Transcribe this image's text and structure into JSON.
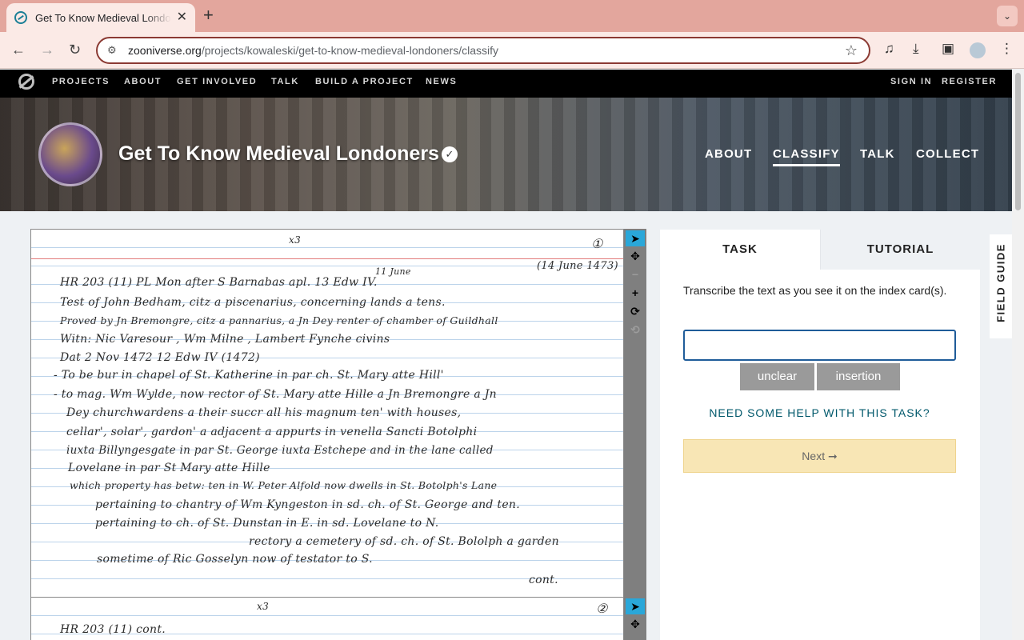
{
  "browser": {
    "tab_title": "Get To Know Medieval Londoners",
    "tab_close": "✕",
    "new_tab": "+",
    "url_host": "zooniverse.org",
    "url_path": "/projects/kowaleski/get-to-know-medieval-londoners/classify"
  },
  "site_nav": {
    "items": [
      "PROJECTS",
      "ABOUT",
      "GET INVOLVED",
      "TALK",
      "BUILD A PROJECT",
      "NEWS"
    ],
    "sign_in": "SIGN IN",
    "register": "REGISTER"
  },
  "project": {
    "title": "Get To Know Medieval Londoners",
    "verified_mark": "✓",
    "nav": [
      "ABOUT",
      "CLASSIFY",
      "TALK",
      "COLLECT"
    ],
    "active_nav": "CLASSIFY"
  },
  "subject_card_1": {
    "corner_number": "①",
    "top_mark": "x3",
    "date_note_top": "11 June",
    "date_note_right": "(14 June 1473)",
    "lines": [
      "HR 203 (11)        PL    Mon after S Barnabas apl.  13 Edw IV.",
      "Test of   John  Bedham,   citz a piscenarius,  concerning  lands a tens.",
      "Proved by   Jn  Bremongre,  citz a pannarius,  a  Jn  Dey   renter of chamber of Guildhall",
      "Witn:   Nic  Varesour ,   Wm  Milne ,  Lambert  Fynche  civins",
      "Dat  2 Nov    1472        12 Edw IV    (1472)",
      "- To  be  bur  in  chapel  of    St. Katherine  in  par  ch.   St. Mary  atte  Hill'",
      "- to  mag.  Wm  Wylde,  now  rector  of  St. Mary  atte  Hille  a  Jn  Bremongre a  Jn",
      "Dey   churchwardens  a  their  succr     all  his    magnum  ten'  with  houses,",
      "cellar',   solar',   gardon'  a  adjacent   a  appurts     in   venella  Sancti  Botolphi",
      "iuxta  Billyngesgate    in   par  St. George  iuxta  Estchepe    and  in  the  lane  called",
      "Lovelane    in    par    St  Mary   atte  Hille",
      "which  property  has  betw:    ten   in   W.    Peter  Alfold  now  dwells   in   St. Botolph's Lane",
      "pertaining   to  chantry of   Wm   Kyngeston   in sd. ch.   of   St. George   and   ten.",
      "pertaining    to   ch.  of    St. Dunstan  in  E.   in  sd.   Lovelane   to    N.",
      "rectory  a  cemetery  of   sd.  ch.  of  St. Bololph  a  garden",
      "sometime  of   Ric  Gosselyn     now  of   testator    to    S.",
      "cont."
    ]
  },
  "subject_card_2": {
    "corner_number": "②",
    "top_mark": "x3",
    "first_line": "HR  203  (11)    cont."
  },
  "viewer_tools": {
    "pointer": "➤",
    "move": "✥",
    "zoom_out": "−",
    "zoom_in": "+",
    "rotate": "⟳",
    "reset": "⟲"
  },
  "task_panel": {
    "tab_task": "TASK",
    "tab_tutorial": "TUTORIAL",
    "instruction": "Transcribe the text as you see it on the index card(s).",
    "answer_value": "",
    "unclear_label": "unclear",
    "insertion_label": "insertion",
    "help_link": "NEED SOME HELP WITH THIS TASK?",
    "next_label": "Next ➞"
  },
  "field_guide": {
    "label": "FIELD GUIDE"
  }
}
